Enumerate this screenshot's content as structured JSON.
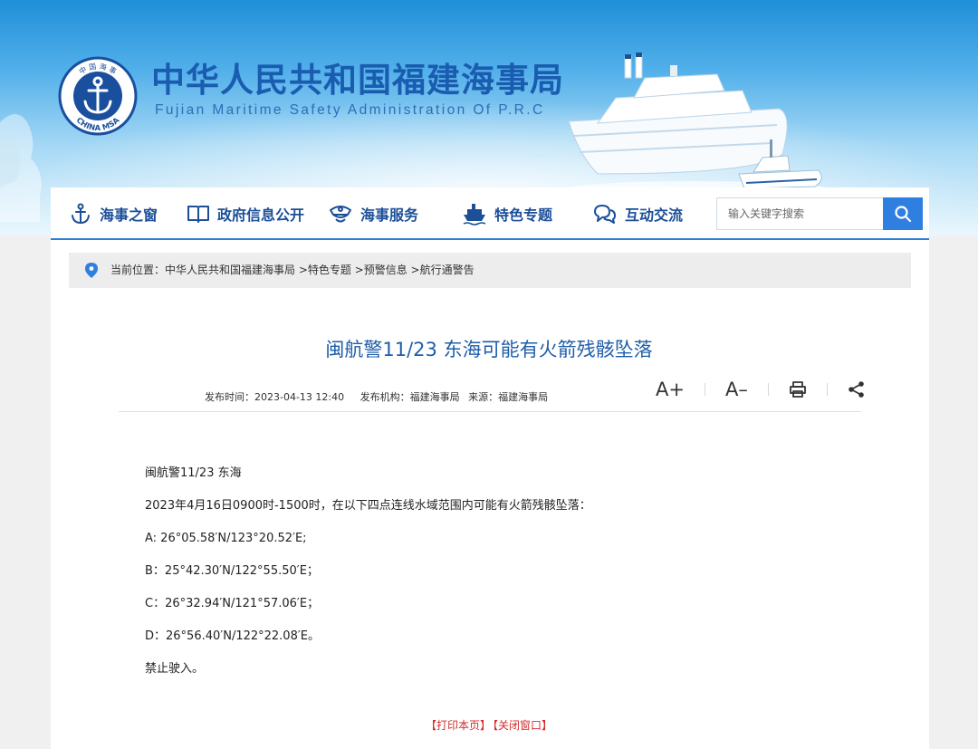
{
  "header": {
    "title": "中华人民共和国福建海事局",
    "subtitle": "Fujian Maritime Safety Administration Of P.R.C",
    "logo_text_top": "中 国 海 事",
    "logo_text_bottom": "CHINA MSA"
  },
  "nav": {
    "items": [
      {
        "label": "海事之窗",
        "icon": "anchor-icon"
      },
      {
        "label": "政府信息公开",
        "icon": "book-icon"
      },
      {
        "label": "海事服务",
        "icon": "captain-hat-icon"
      },
      {
        "label": "特色专题",
        "icon": "ship-icon"
      },
      {
        "label": "互动交流",
        "icon": "chat-icon"
      }
    ],
    "search_placeholder": "输入关键字搜索"
  },
  "breadcrumb": {
    "text": "当前位置：中华人民共和国福建海事局 >特色专题 >预警信息 >航行通警告"
  },
  "article": {
    "title": "闽航警11/23 东海可能有火箭残骸坠落",
    "publish_time": "发布时间：2023-04-13 12:40",
    "publisher": "发布机构：福建海事局",
    "source": "来源：福建海事局",
    "tools": {
      "font_larger": "A+",
      "font_smaller": "A–"
    },
    "paragraphs": [
      "闽航警11/23  东海",
      "2023年4月16日0900时-1500时，在以下四点连线水域范围内可能有火箭残骸坠落：",
      "A:  26°05.58′N/123°20.52′E;",
      "B：25°42.30′N/122°55.50′E；",
      "C：26°32.94′N/121°57.06′E；",
      "D：26°56.40′N/122°22.08′E。",
      "禁止驶入。"
    ]
  },
  "footer": {
    "print_link": "【打印本页】",
    "close_link": "【关闭窗口】"
  },
  "colors": {
    "brand_blue": "#1c4f98",
    "title_blue": "#1f5ea8",
    "search_button": "#2f7fe0",
    "footer_link_red": "#d32d2d"
  }
}
